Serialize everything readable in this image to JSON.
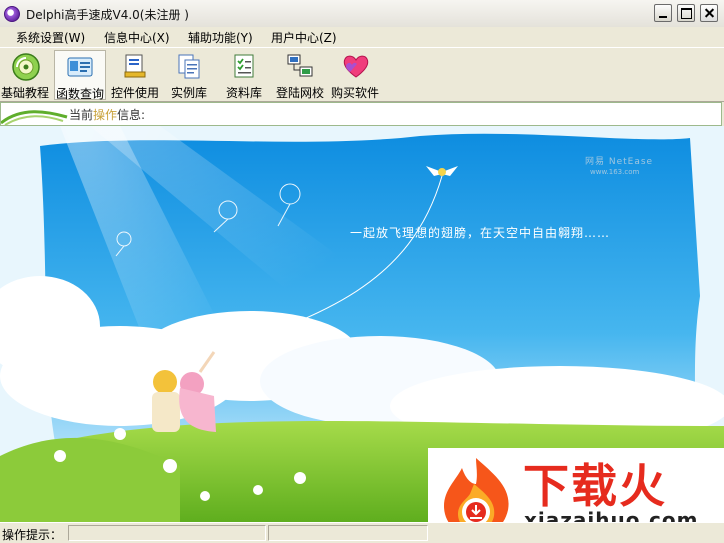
{
  "window": {
    "title": "Delphi高手速成V4.0(未注册 )"
  },
  "menu": [
    "系统设置(W)",
    "信息中心(X)",
    "辅助功能(Y)",
    "用户中心(Z)"
  ],
  "toolbar": [
    {
      "label": "基础教程",
      "icon": "disc-icon"
    },
    {
      "label": "函数查询",
      "icon": "id-card-icon"
    },
    {
      "label": "控件使用",
      "icon": "book-icon"
    },
    {
      "label": "实例库",
      "icon": "documents-icon"
    },
    {
      "label": "资料库",
      "icon": "checklist-icon"
    },
    {
      "label": "登陆网校",
      "icon": "network-icon"
    },
    {
      "label": "购买软件",
      "icon": "heart-icon"
    }
  ],
  "info": {
    "prefix": "当前",
    "highlight": "操作",
    "suffix": "信息:"
  },
  "scene": {
    "slogan": "一起放飞理想的翅膀，在天空中自由翱翔……",
    "watermark": "网易 NetEase",
    "watermark_url": "www.163.com"
  },
  "logo": {
    "main": "下载火",
    "sub": "xiazaihuo.com"
  },
  "status": {
    "label": "操作提示："
  },
  "colors": {
    "sky": "#2aa6e8",
    "grass": "#7cc52a",
    "logo_red": "#e62b1e",
    "info_border": "#9db98c"
  }
}
